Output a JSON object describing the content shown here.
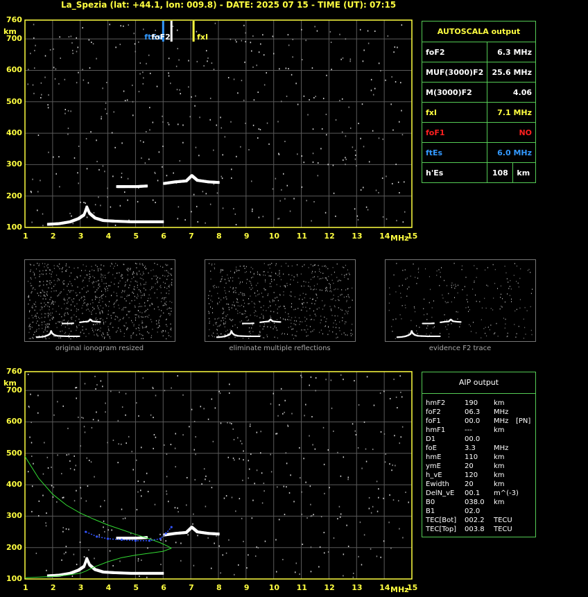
{
  "header": {
    "title": "La_Spezia (lat: +44.1, lon: 009.8) - DATE: 2025 07 15 - TIME (UT): 07:15"
  },
  "axes": {
    "y_unit": "km",
    "x_unit": "MHz",
    "x_ticks": [
      "1",
      "2",
      "3",
      "4",
      "5",
      "6",
      "7",
      "8",
      "9",
      "10",
      "11",
      "12",
      "13",
      "14",
      "15"
    ],
    "y_ticks": [
      "760",
      "700",
      "600",
      "500",
      "400",
      "300",
      "200",
      "100"
    ]
  },
  "markers": {
    "ftEs": "ftEs",
    "foF2": "foF2",
    "fxI": "fxI"
  },
  "autoscala": {
    "title": "AUTOSCALA output",
    "rows": [
      {
        "label": "foF2",
        "value": "6.3 MHz",
        "color": "#ffffff"
      },
      {
        "label": "MUF(3000)F2",
        "value": "25.6 MHz",
        "color": "#ffffff"
      },
      {
        "label": "M(3000)F2",
        "value": "4.06",
        "color": "#ffffff"
      },
      {
        "label": "fxI",
        "value": "7.1 MHz",
        "color": "#ffff40"
      },
      {
        "label": "foF1",
        "value": "NO",
        "color": "#ff2020"
      },
      {
        "label": "ftEs",
        "value": "6.0 MHz",
        "color": "#3399ff"
      },
      {
        "label": "h'Es",
        "value": "108",
        "unit": "km",
        "color": "#ffffff"
      }
    ]
  },
  "thumbnails": [
    {
      "caption": "original ionogram resized"
    },
    {
      "caption": "eliminate multiple reflections"
    },
    {
      "caption": "evidence F2 trace"
    }
  ],
  "aip": {
    "title": "AIP output",
    "rows": [
      {
        "name": "hmF2",
        "value": "190",
        "unit": "km",
        "extra": ""
      },
      {
        "name": "foF2",
        "value": "06.3",
        "unit": "MHz",
        "extra": ""
      },
      {
        "name": "foF1",
        "value": "00.0",
        "unit": "MHz",
        "extra": "[PN]"
      },
      {
        "name": "hmF1",
        "value": "---",
        "unit": "km",
        "extra": ""
      },
      {
        "name": "D1",
        "value": "00.0",
        "unit": "",
        "extra": ""
      },
      {
        "name": "foE",
        "value": "3.3",
        "unit": "MHz",
        "extra": ""
      },
      {
        "name": "hmE",
        "value": "110",
        "unit": "km",
        "extra": ""
      },
      {
        "name": "ymE",
        "value": "20",
        "unit": "km",
        "extra": ""
      },
      {
        "name": "h_vE",
        "value": "120",
        "unit": "km",
        "extra": ""
      },
      {
        "name": "Ewidth",
        "value": "20",
        "unit": "km",
        "extra": ""
      },
      {
        "name": "DelN_vE",
        "value": "00.1",
        "unit": "m^(-3)",
        "extra": ""
      },
      {
        "name": "B0",
        "value": "038.0",
        "unit": "km",
        "extra": ""
      },
      {
        "name": "B1",
        "value": "02.0",
        "unit": "",
        "extra": ""
      },
      {
        "name": "TEC[Bot]",
        "value": "002.2",
        "unit": "TECU",
        "extra": ""
      },
      {
        "name": "TEC[Top]",
        "value": "003.8",
        "unit": "TECU",
        "extra": ""
      }
    ]
  },
  "chart_data": [
    {
      "type": "scatter",
      "xlabel": "MHz",
      "ylabel": "km",
      "xlim": [
        1,
        15
      ],
      "ylim": [
        100,
        760
      ],
      "grid": true,
      "series": [
        {
          "name": "E trace",
          "color": "#ffffff",
          "points": [
            [
              1.8,
              110
            ],
            [
              2.2,
              112
            ],
            [
              2.6,
              118
            ],
            [
              2.9,
              128
            ],
            [
              3.1,
              140
            ],
            [
              3.2,
              165
            ],
            [
              3.3,
              145
            ],
            [
              3.5,
              130
            ],
            [
              3.8,
              122
            ],
            [
              4.2,
              120
            ],
            [
              4.8,
              118
            ],
            [
              5.4,
              118
            ],
            [
              6.0,
              118
            ]
          ]
        },
        {
          "name": "Es trace",
          "color": "#ffffff",
          "points": [
            [
              4.3,
              230
            ],
            [
              4.6,
              230
            ],
            [
              5.0,
              230
            ],
            [
              5.4,
              232
            ]
          ]
        },
        {
          "name": "F2 trace",
          "color": "#ffffff",
          "points": [
            [
              6.0,
              240
            ],
            [
              6.4,
              245
            ],
            [
              6.8,
              248
            ],
            [
              7.0,
              265
            ],
            [
              7.2,
              250
            ],
            [
              7.6,
              245
            ],
            [
              8.0,
              243
            ]
          ]
        }
      ],
      "markers": [
        {
          "label": "ftEs",
          "x": 6.0
        },
        {
          "label": "foF2",
          "x": 6.3
        },
        {
          "label": "fxI",
          "x": 7.1
        }
      ]
    },
    {
      "type": "line",
      "xlabel": "MHz",
      "ylabel": "km",
      "xlim": [
        1,
        15
      ],
      "ylim": [
        100,
        760
      ],
      "grid": true,
      "series": [
        {
          "name": "topside profile",
          "color": "#33dd33",
          "points": [
            [
              1.0,
              490
            ],
            [
              1.5,
              420
            ],
            [
              2.0,
              370
            ],
            [
              2.5,
              335
            ],
            [
              3.0,
              310
            ],
            [
              3.5,
              290
            ],
            [
              4.0,
              272
            ],
            [
              4.5,
              257
            ],
            [
              5.0,
              242
            ],
            [
              5.5,
              228
            ],
            [
              5.9,
              215
            ],
            [
              6.15,
              205
            ],
            [
              6.3,
              198
            ]
          ]
        },
        {
          "name": "bottomside profile",
          "color": "#33dd33",
          "points": [
            [
              6.3,
              198
            ],
            [
              6.0,
              188
            ],
            [
              5.5,
              182
            ],
            [
              5.0,
              176
            ],
            [
              4.5,
              168
            ],
            [
              4.0,
              155
            ],
            [
              3.5,
              138
            ],
            [
              3.2,
              125
            ],
            [
              3.0,
              118
            ],
            [
              2.5,
              112
            ],
            [
              2.0,
              108
            ],
            [
              1.0,
              104
            ]
          ]
        },
        {
          "name": "true height",
          "color": "#3355ff",
          "points": [
            [
              3.2,
              250
            ],
            [
              3.6,
              235
            ],
            [
              4.0,
              228
            ],
            [
              4.5,
              225
            ],
            [
              5.0,
              222
            ],
            [
              5.5,
              222
            ],
            [
              5.9,
              228
            ],
            [
              6.1,
              245
            ],
            [
              6.3,
              265
            ]
          ]
        }
      ]
    }
  ]
}
